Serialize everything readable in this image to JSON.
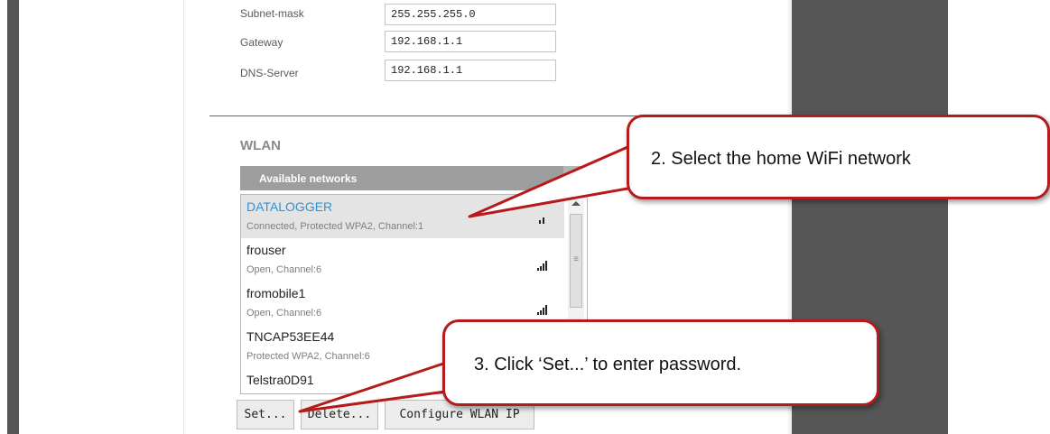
{
  "ip_settings": {
    "fields": [
      {
        "label": "Subnet-mask",
        "value": "255.255.255.0"
      },
      {
        "label": "Gateway",
        "value": "192.168.1.1"
      },
      {
        "label": "DNS-Server",
        "value": "192.168.1.1"
      }
    ]
  },
  "wlan": {
    "section_title": "WLAN",
    "panel_title": "Available networks",
    "refresh_icon": "refresh-icon",
    "networks": [
      {
        "name": "DATALOGGER",
        "detail": "Connected, Protected WPA2, Channel:1",
        "selected": true,
        "signal_bars": 2
      },
      {
        "name": "frouser",
        "detail": "Open, Channel:6",
        "selected": false,
        "signal_bars": 4
      },
      {
        "name": "fromobile1",
        "detail": "Open, Channel:6",
        "selected": false,
        "signal_bars": 3
      },
      {
        "name": "TNCAP53EE44",
        "detail": "Protected WPA2, Channel:6",
        "selected": false,
        "signal_bars": 4
      },
      {
        "name": "Telstra0D91",
        "detail": "",
        "selected": false,
        "signal_bars": 0
      }
    ],
    "buttons": {
      "set": "Set...",
      "delete": "Delete...",
      "configure": "Configure WLAN IP"
    }
  },
  "annotations": {
    "step2": "2. Select the home WiFi network",
    "step3": "3. Click ‘Set...’ to enter password."
  },
  "colors": {
    "selected_name": "#2c93d6",
    "callout_border": "#b61a1a",
    "dark_panel": "#565656"
  }
}
